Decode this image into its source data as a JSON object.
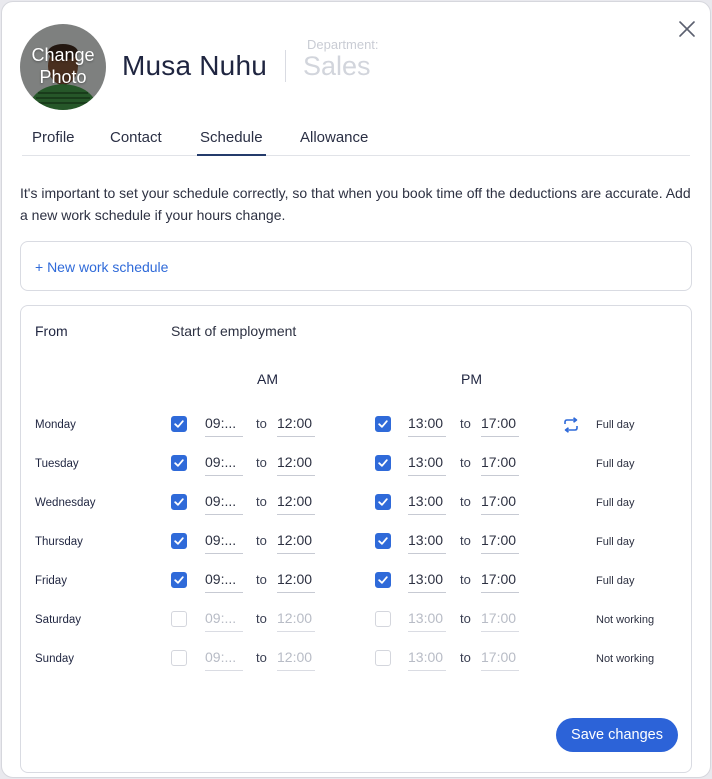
{
  "modal": {
    "avatar_label": "Change Photo",
    "name": "Musa Nuhu",
    "department_label": "Department:",
    "department_value": "Sales",
    "close_icon": "close-icon"
  },
  "tabs": [
    {
      "label": "Profile",
      "active": false
    },
    {
      "label": "Contact",
      "active": false
    },
    {
      "label": "Schedule",
      "active": true
    },
    {
      "label": "Allowance",
      "active": false
    }
  ],
  "intro_text": "It's important to set your schedule correctly, so that when you book time off the deductions are accurate. Add a new work schedule if your hours change.",
  "new_schedule_link": "+ New work schedule",
  "schedule": {
    "from_label": "From",
    "from_value": "Start of employment",
    "am_header": "AM",
    "pm_header": "PM",
    "to_label": "to",
    "days": [
      {
        "day": "Monday",
        "am_checked": true,
        "am_start": "09:...",
        "am_end": "12:00",
        "pm_checked": true,
        "pm_start": "13:00",
        "pm_end": "17:00",
        "status": "Full day"
      },
      {
        "day": "Tuesday",
        "am_checked": true,
        "am_start": "09:...",
        "am_end": "12:00",
        "pm_checked": true,
        "pm_start": "13:00",
        "pm_end": "17:00",
        "status": "Full day"
      },
      {
        "day": "Wednesday",
        "am_checked": true,
        "am_start": "09:...",
        "am_end": "12:00",
        "pm_checked": true,
        "pm_start": "13:00",
        "pm_end": "17:00",
        "status": "Full day"
      },
      {
        "day": "Thursday",
        "am_checked": true,
        "am_start": "09:...",
        "am_end": "12:00",
        "pm_checked": true,
        "pm_start": "13:00",
        "pm_end": "17:00",
        "status": "Full day"
      },
      {
        "day": "Friday",
        "am_checked": true,
        "am_start": "09:...",
        "am_end": "12:00",
        "pm_checked": true,
        "pm_start": "13:00",
        "pm_end": "17:00",
        "status": "Full day"
      },
      {
        "day": "Saturday",
        "am_checked": false,
        "am_start": "09:...",
        "am_end": "12:00",
        "pm_checked": false,
        "pm_start": "13:00",
        "pm_end": "17:00",
        "status": "Not working"
      },
      {
        "day": "Sunday",
        "am_checked": false,
        "am_start": "09:...",
        "am_end": "12:00",
        "pm_checked": false,
        "pm_start": "13:00",
        "pm_end": "17:00",
        "status": "Not working"
      }
    ],
    "repeat_icon": "repeat-icon"
  },
  "save_label": "Save changes",
  "colors": {
    "accent": "#2c63d8",
    "link": "#2f6ad9",
    "tab_underline": "#243b6b"
  }
}
